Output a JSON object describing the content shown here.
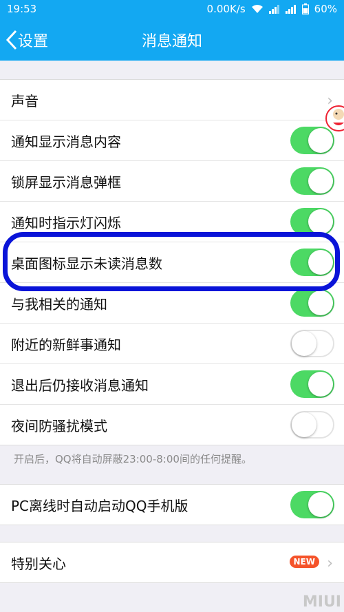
{
  "status_bar": {
    "time": "19:53",
    "network_speed": "0.00K/s",
    "battery": "60%"
  },
  "nav": {
    "back_label": "设置",
    "title": "消息通知"
  },
  "group1": [
    {
      "label": "声音",
      "control": "chevron"
    },
    {
      "label": "通知显示消息内容",
      "control": "toggle",
      "on": true
    },
    {
      "label": "锁屏显示消息弹框",
      "control": "toggle",
      "on": true
    },
    {
      "label": "通知时指示灯闪烁",
      "control": "toggle",
      "on": true
    },
    {
      "label": "桌面图标显示未读消息数",
      "control": "toggle",
      "on": true
    },
    {
      "label": "与我相关的通知",
      "control": "toggle",
      "on": true
    },
    {
      "label": "附近的新鲜事通知",
      "control": "toggle",
      "on": false
    },
    {
      "label": "退出后仍接收消息通知",
      "control": "toggle",
      "on": true
    },
    {
      "label": "夜间防骚扰模式",
      "control": "toggle",
      "on": false
    }
  ],
  "night_mode_note": "开启后，QQ将自动屏蔽23:00-8:00间的任何提醒。",
  "pc_offline": {
    "label": "PC离线时自动启动QQ手机版",
    "on": true
  },
  "special_care": {
    "label": "特别关心",
    "badge": "NEW"
  },
  "watermark": "MIUI",
  "colors": {
    "accent": "#13a8f2",
    "toggle_on": "#4cd964",
    "highlight": "#0a14d8",
    "badge": "#f5532a"
  }
}
